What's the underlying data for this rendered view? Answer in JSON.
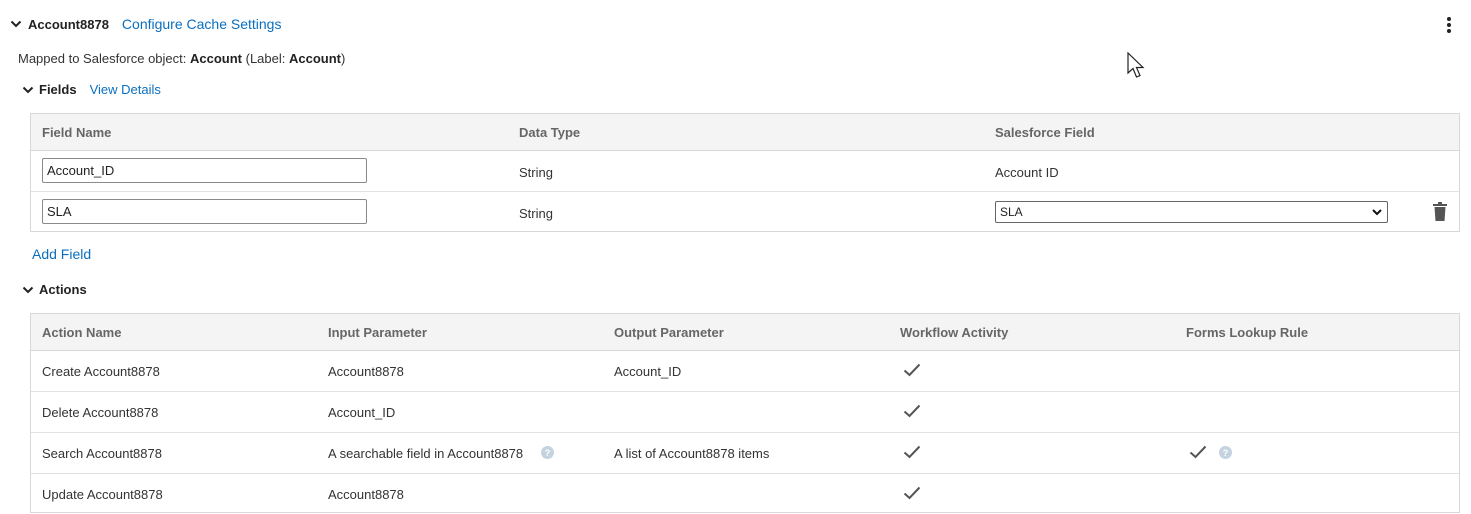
{
  "object": {
    "name": "Account8878",
    "configure_link": "Configure Cache Settings",
    "mapped_prefix": "Mapped to Salesforce object: ",
    "mapped_object": "Account",
    "label_prefix": " (Label: ",
    "label_value": "Account",
    "label_suffix": ")"
  },
  "fields": {
    "title": "Fields",
    "details_link": "View Details",
    "columns": [
      "Field Name",
      "Data Type",
      "Salesforce Field"
    ],
    "rows": [
      {
        "field_name": "Account_ID",
        "data_type": "String",
        "salesforce_field": "Account ID"
      },
      {
        "field_name": "SLA",
        "data_type": "String",
        "salesforce_field": "SLA"
      }
    ],
    "add_link": "Add Field"
  },
  "actions": {
    "title": "Actions",
    "columns": [
      "Action Name",
      "Input Parameter",
      "Output Parameter",
      "Workflow Activity",
      "Forms Lookup Rule"
    ],
    "rows": [
      {
        "name": "Create Account8878",
        "input": "Account8878",
        "output": "Account_ID",
        "workflow": true,
        "forms": false
      },
      {
        "name": "Delete Account8878",
        "input": "Account_ID",
        "output": "",
        "workflow": true,
        "forms": false
      },
      {
        "name": "Search Account8878",
        "input": "A searchable field in Account8878",
        "output": "A list of Account8878 items",
        "workflow": true,
        "forms": true
      },
      {
        "name": "Update Account8878",
        "input": "Account8878",
        "output": "",
        "workflow": true,
        "forms": false
      }
    ]
  },
  "colors": {
    "link": "#0a6fbf",
    "header_bg": "#f4f4f4",
    "border": "#d8d8d8"
  },
  "icons": [
    "chevron-down-icon",
    "kebab-menu-icon",
    "trash-icon",
    "check-icon",
    "help-icon",
    "dropdown-arrow-icon",
    "mouse-cursor-icon"
  ]
}
